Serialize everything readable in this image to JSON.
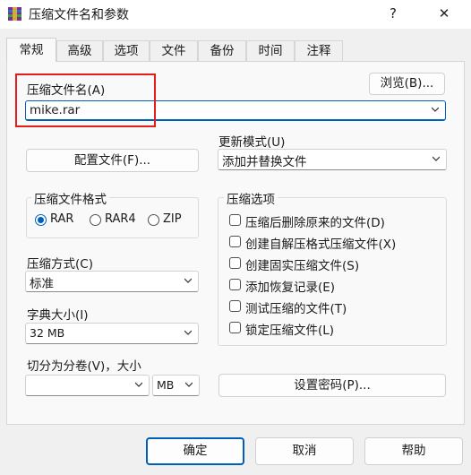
{
  "window": {
    "title": "压缩文件名和参数",
    "help_glyph": "?",
    "close_glyph": "✕"
  },
  "tabs": [
    "常规",
    "高级",
    "选项",
    "文件",
    "备份",
    "时间",
    "注释"
  ],
  "archive": {
    "label": "压缩文件名(A)",
    "value": "mike.rar",
    "browse_label": "浏览(B)..."
  },
  "profiles_label": "配置文件(F)...",
  "update_mode": {
    "label": "更新模式(U)",
    "value": "添加并替换文件"
  },
  "format": {
    "title": "压缩文件格式",
    "options": [
      "RAR",
      "RAR4",
      "ZIP"
    ],
    "selected": "RAR"
  },
  "compression_method": {
    "label": "压缩方式(C)",
    "value": "标准"
  },
  "dictionary": {
    "label": "字典大小(I)",
    "value": "32 MB"
  },
  "split": {
    "label": "切分为分卷(V)，大小",
    "value": "",
    "unit": "MB"
  },
  "options": {
    "title": "压缩选项",
    "items": [
      "压缩后删除原来的文件(D)",
      "创建自解压格式压缩文件(X)",
      "创建固实压缩文件(S)",
      "添加恢复记录(E)",
      "测试压缩的文件(T)",
      "锁定压缩文件(L)"
    ]
  },
  "set_password_label": "设置密码(P)...",
  "buttons": {
    "ok": "确定",
    "cancel": "取消",
    "help": "帮助"
  },
  "highlight_color": "#e31c1c",
  "accent_color": "#005fb8"
}
